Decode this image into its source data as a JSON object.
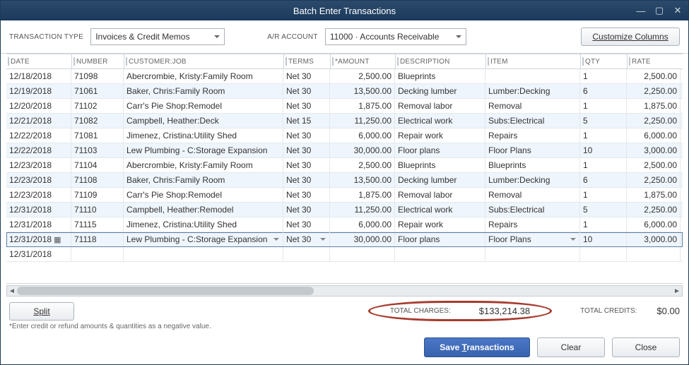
{
  "window": {
    "title": "Batch Enter Transactions"
  },
  "toolbar": {
    "transaction_type_label": "TRANSACTION TYPE",
    "transaction_type_value": "Invoices & Credit Memos",
    "ar_account_label": "A/R ACCOUNT",
    "ar_account_value": "11000 · Accounts Receivable",
    "customize_label": "Customize Columns"
  },
  "columns": {
    "date": "DATE",
    "number": "NUMBER",
    "customer": "CUSTOMER:JOB",
    "terms": "TERMS",
    "amount": "*AMOUNT",
    "description": "DESCRIPTION",
    "item": "ITEM",
    "qty": "QTY",
    "rate": "RATE"
  },
  "rows": [
    {
      "date": "12/18/2018",
      "number": "71098",
      "customer": "Abercrombie, Kristy:Family Room",
      "terms": "Net 30",
      "amount": "2,500.00",
      "description": "Blueprints",
      "item": "",
      "qty": "1",
      "rate": "2,500.00"
    },
    {
      "date": "12/19/2018",
      "number": "71061",
      "customer": "Baker, Chris:Family Room",
      "terms": "Net 30",
      "amount": "13,500.00",
      "description": "Decking lumber",
      "item": "Lumber:Decking",
      "qty": "6",
      "rate": "2,250.00"
    },
    {
      "date": "12/20/2018",
      "number": "71102",
      "customer": "Carr's Pie Shop:Remodel",
      "terms": "Net 30",
      "amount": "1,875.00",
      "description": "Removal labor",
      "item": "Removal",
      "qty": "1",
      "rate": "1,875.00"
    },
    {
      "date": "12/21/2018",
      "number": "71082",
      "customer": "Campbell, Heather:Deck",
      "terms": "Net 15",
      "amount": "11,250.00",
      "description": "Electrical work",
      "item": "Subs:Electrical",
      "qty": "5",
      "rate": "2,250.00"
    },
    {
      "date": "12/22/2018",
      "number": "71081",
      "customer": "Jimenez, Cristina:Utility Shed",
      "terms": "Net 30",
      "amount": "6,000.00",
      "description": "Repair work",
      "item": "Repairs",
      "qty": "1",
      "rate": "6,000.00"
    },
    {
      "date": "12/22/2018",
      "number": "71103",
      "customer": "Lew Plumbing - C:Storage Expansion",
      "terms": "Net 30",
      "amount": "30,000.00",
      "description": "Floor plans",
      "item": "Floor Plans",
      "qty": "10",
      "rate": "3,000.00"
    },
    {
      "date": "12/23/2018",
      "number": "71104",
      "customer": "Abercrombie, Kristy:Family Room",
      "terms": "Net 30",
      "amount": "2,500.00",
      "description": "Blueprints",
      "item": "Blueprints",
      "qty": "1",
      "rate": "2,500.00"
    },
    {
      "date": "12/23/2018",
      "number": "71108",
      "customer": "Baker, Chris:Family Room",
      "terms": "Net 30",
      "amount": "13,500.00",
      "description": "Decking lumber",
      "item": "Lumber:Decking",
      "qty": "6",
      "rate": "2,250.00"
    },
    {
      "date": "12/23/2018",
      "number": "71109",
      "customer": "Carr's Pie Shop:Remodel",
      "terms": "Net 30",
      "amount": "1,875.00",
      "description": "Removal labor",
      "item": "Removal",
      "qty": "1",
      "rate": "1,875.00"
    },
    {
      "date": "12/31/2018",
      "number": "71110",
      "customer": "Campbell, Heather:Remodel",
      "terms": "Net 30",
      "amount": "11,250.00",
      "description": "Electrical work",
      "item": "Subs:Electrical",
      "qty": "5",
      "rate": "2,250.00"
    },
    {
      "date": "12/31/2018",
      "number": "71115",
      "customer": "Jimenez, Cristina:Utility Shed",
      "terms": "Net 30",
      "amount": "6,000.00",
      "description": "Repair work",
      "item": "Repairs",
      "qty": "1",
      "rate": "6,000.00"
    },
    {
      "date": "12/31/2018",
      "number": "71118",
      "customer": "Lew Plumbing - C:Storage Expansion",
      "terms": "Net 30",
      "amount": "30,000.00",
      "description": "Floor plans",
      "item": "Floor Plans",
      "qty": "10",
      "rate": "3,000.00",
      "active": true
    },
    {
      "date": "12/31/2018",
      "number": "",
      "customer": "",
      "terms": "",
      "amount": "",
      "description": "",
      "item": "",
      "qty": "",
      "rate": ""
    }
  ],
  "footer": {
    "split_label": "Split",
    "total_charges_label": "TOTAL CHARGES:",
    "total_charges_value": "$133,214.38",
    "total_credits_label": "TOTAL CREDITS:",
    "total_credits_value": "$0.00",
    "footnote": "*Enter credit or refund amounts & quantities as a negative value.",
    "save_label": "Save Transactions",
    "clear_label": "Clear",
    "close_label": "Close"
  }
}
